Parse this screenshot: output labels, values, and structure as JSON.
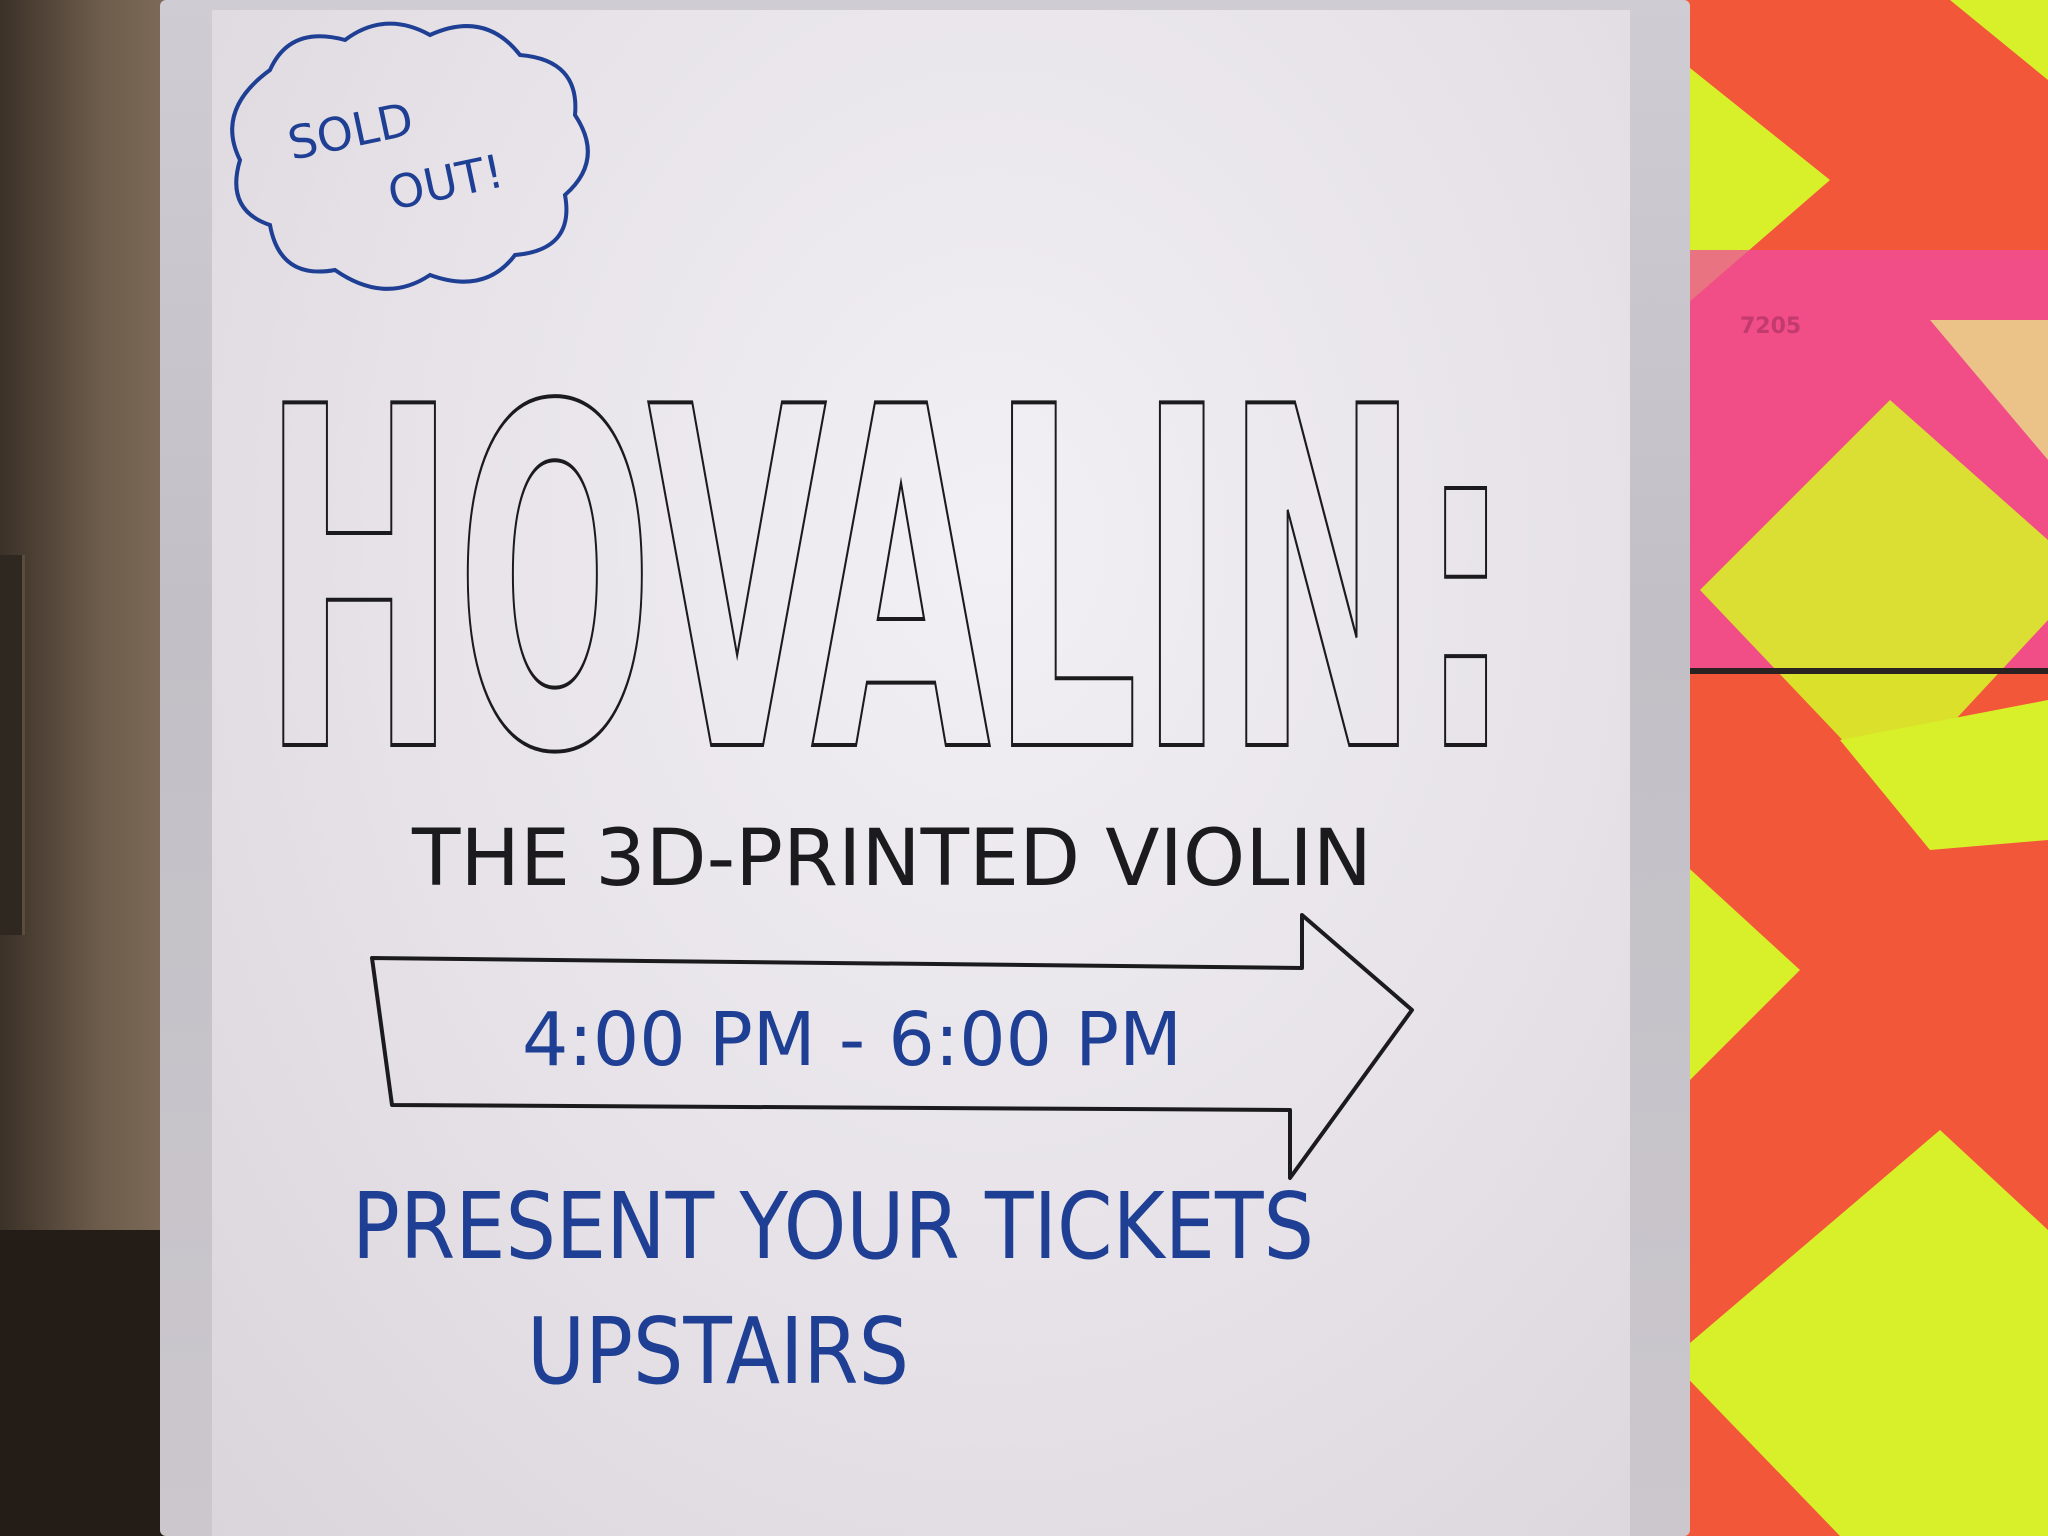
{
  "whiteboard": {
    "badge_line1": "SOLD",
    "badge_line2": "OUT!",
    "title": "HOVALIN:",
    "subtitle": "THE 3D-PRINTED VIOLIN",
    "time_range": "4:00 PM - 6:00 PM",
    "instruction_line1": "PRESENT YOUR TICKETS",
    "instruction_line2": "UPSTAIRS"
  },
  "background": {
    "room_number": "7205"
  },
  "colors": {
    "marker_black": "#1b1b1d",
    "marker_blue": "#1e3f93",
    "backdrop_red": "#f2573a",
    "backdrop_yellow": "#d8f02a",
    "backdrop_pink": "#f04aa0"
  }
}
